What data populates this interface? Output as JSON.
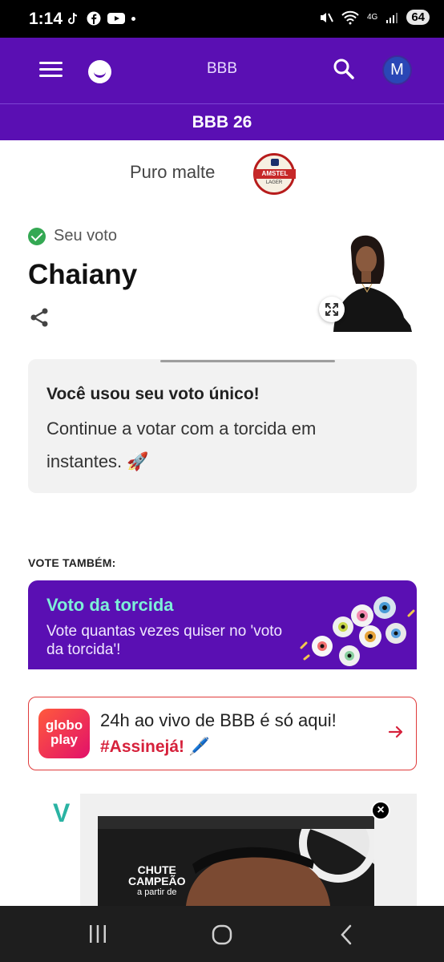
{
  "status_bar": {
    "time": "1:14",
    "battery": "64",
    "network": "4G",
    "signal_small": "5"
  },
  "header": {
    "title": "BBB",
    "avatar_initial": "M"
  },
  "subheader": {
    "title": "BBB 26"
  },
  "sponsor": {
    "text": "Puro malte",
    "brand_band": "AMSTEL",
    "brand_small": "LAGER"
  },
  "vote": {
    "label": "Seu voto",
    "name": "Chaiany"
  },
  "info_card": {
    "title": "Você usou seu voto único!",
    "body": "Continue a votar com a torcida em instantes. 🚀"
  },
  "vote_also": {
    "label": "VOTE TAMBÉM:"
  },
  "promo": {
    "title": "Voto da torcida",
    "subtitle": "Vote quantas vezes quiser no 'voto da torcida'!"
  },
  "globoplay": {
    "logo_line1": "globo",
    "logo_line2": "play",
    "text1": "24h ao vivo de BBB é só aqui!",
    "text2": "#Assinejá! 🖊️"
  },
  "ad": {
    "brand_letter": "V",
    "line1": "CHUTE",
    "line2": "CAMPEÃO",
    "line3": "a partir de",
    "close": "×"
  },
  "colors": {
    "brand_purple": "#5a0fb3",
    "accent_teal": "#7df0d8",
    "alert_red": "#d6213b",
    "check_green": "#34a853"
  },
  "icons": [
    "tiktok-icon",
    "facebook-icon",
    "youtube-icon",
    "mute-icon",
    "wifi-icon",
    "signal-icon",
    "menu-icon",
    "globo-smile-icon",
    "search-icon",
    "share-icon",
    "expand-icon",
    "arrow-right-icon",
    "recents-icon",
    "home-icon",
    "back-icon"
  ]
}
